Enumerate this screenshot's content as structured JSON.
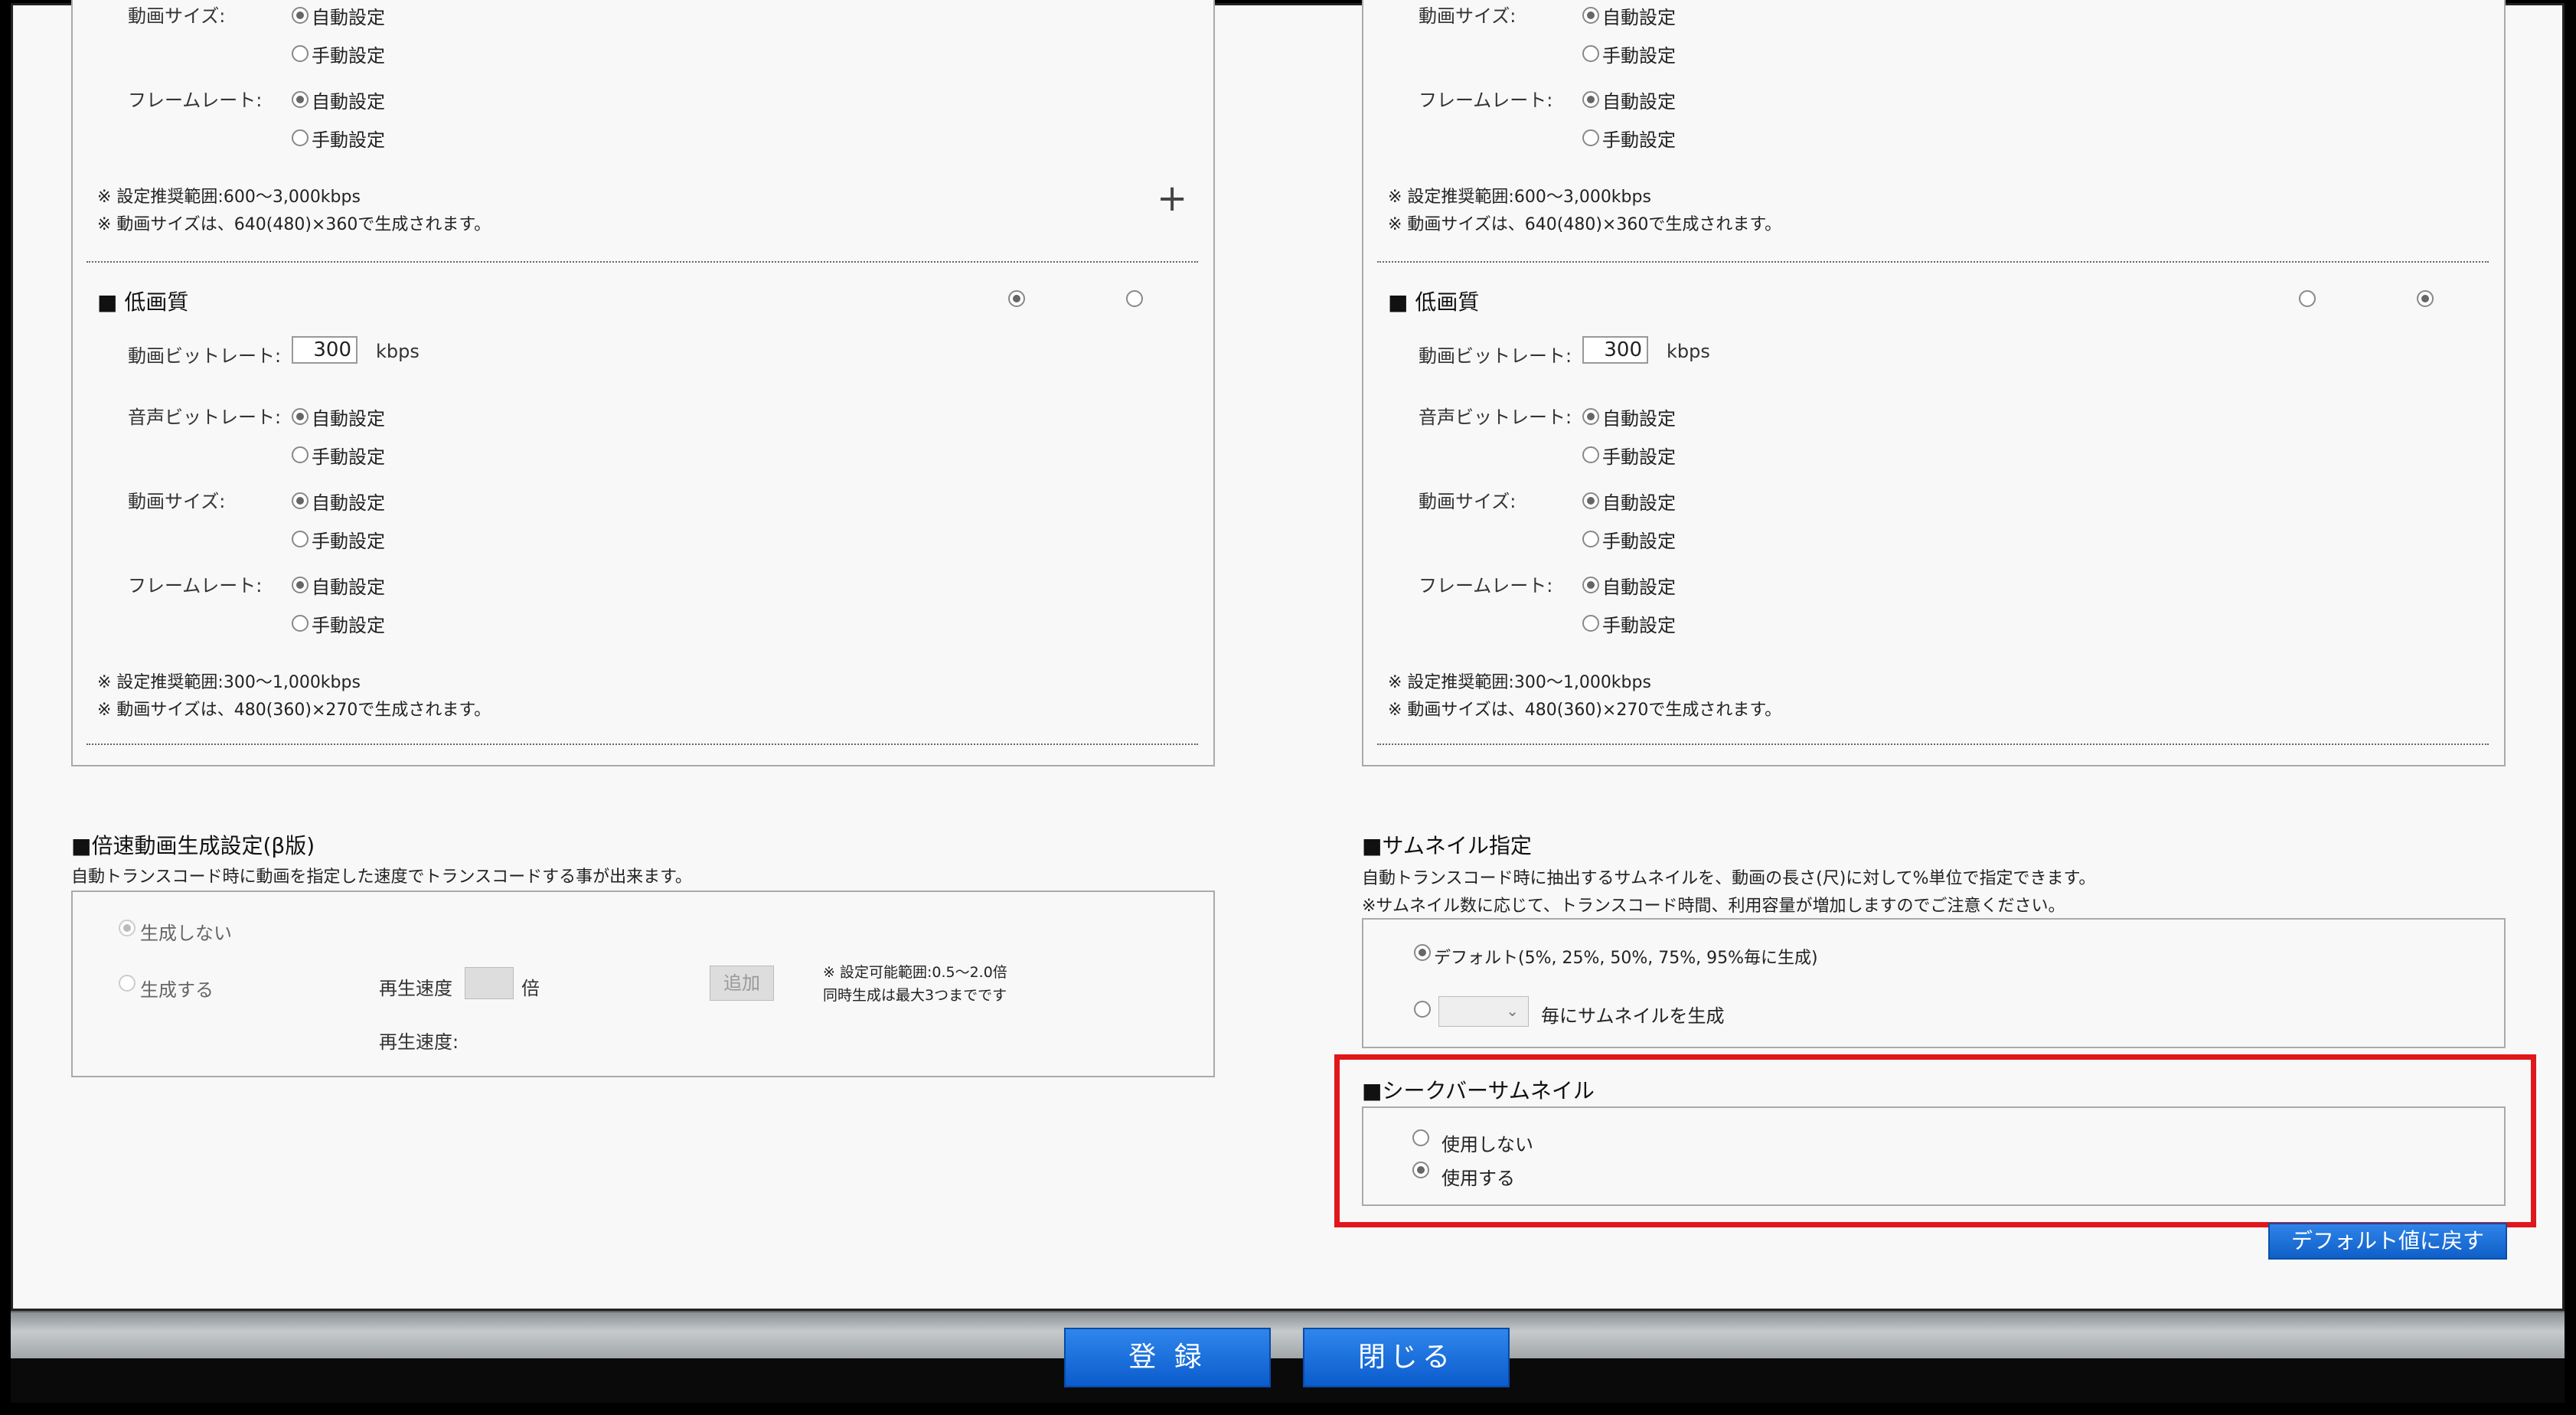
{
  "common": {
    "auto": "自動設定",
    "manual": "手動設定",
    "kbps": "kbps",
    "bitrate_label": "動画ビットレート:",
    "audio_label": "音声ビットレート:",
    "size_label": "動画サイズ:",
    "fps_label": "フレームレート:",
    "low_title": "■ 低画質",
    "mid_note1": "※ 設定推奨範囲:600～3,000kbps",
    "mid_note2": "※ 動画サイズは、640(480)×360で生成されます。",
    "low_note1": "※ 設定推奨範囲:300～1,000kbps",
    "low_note2": "※ 動画サイズは、480(360)×270で生成されます。",
    "low_bitrate_value": "300"
  },
  "speed": {
    "title": "■倍速動画生成設定(β版)",
    "description": "自動トランスコード時に動画を指定した速度でトランスコードする事が出来ます。",
    "no_generate": "生成しない",
    "generate": "生成する",
    "speed_label": "再生速度",
    "times": "倍",
    "add": "追加",
    "note1": "※ 設定可能範囲:0.5～2.0倍",
    "note2": "同時生成は最大3つまでです",
    "speed_label2": "再生速度:"
  },
  "thumbnail": {
    "title": "■サムネイル指定",
    "desc1": "自動トランスコード時に抽出するサムネイルを、動画の長さ(尺)に対して%単位で指定できます。",
    "desc2": "※サムネイル数に応じて、トランスコード時間、利用容量が増加しますのでご注意ください。",
    "default_option": "デフォルト(5%, 25%, 50%, 75%, 95%毎に生成)",
    "every_option": "毎にサムネイルを生成"
  },
  "seekbar": {
    "title": "■シークバーサムネイル",
    "not_use": "使用しない",
    "use": "使用する"
  },
  "buttons": {
    "reset_default": "デフォルト値に戻す",
    "register": "登 録",
    "close": "閉じる"
  },
  "colors": {
    "highlight_red": "#e0171b",
    "button_blue": "#0f5fc8"
  }
}
